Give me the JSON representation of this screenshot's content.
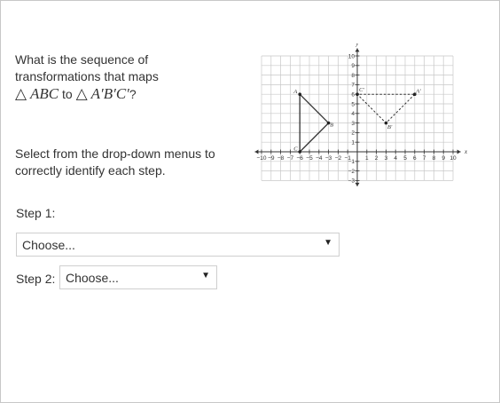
{
  "question": {
    "text": "What is the sequence of transformations that maps",
    "triangle_symbol": "△",
    "from_triangle": "ABC",
    "connector": " to ",
    "to_triangle": "A′B′C′",
    "end": "?"
  },
  "instructions": "Select from the drop-down menus to correctly identify each step.",
  "graph": {
    "x_ticks": [
      "−10",
      "−9",
      "−8",
      "−7",
      "−6",
      "−5",
      "−4",
      "−3",
      "−2",
      "−1",
      "",
      "1",
      "2",
      "3",
      "4",
      "5",
      "6",
      "7",
      "8",
      "9",
      "10"
    ],
    "y_ticks_pos": [
      "1",
      "2",
      "3",
      "4",
      "5",
      "6",
      "7",
      "8",
      "9",
      "10"
    ],
    "y_ticks_neg": [
      "−1",
      "−2",
      "−3"
    ],
    "x_axis_label": "x",
    "y_axis_label": "y",
    "point_labels": {
      "A": "A",
      "B": "B",
      "C": "C",
      "A2": "A′",
      "B2": "B′",
      "C2": "C′"
    }
  },
  "step1": {
    "label": "Step 1:",
    "value": "Choose..."
  },
  "step2": {
    "label": "Step 2:",
    "value": "Choose..."
  },
  "caret": "▼"
}
